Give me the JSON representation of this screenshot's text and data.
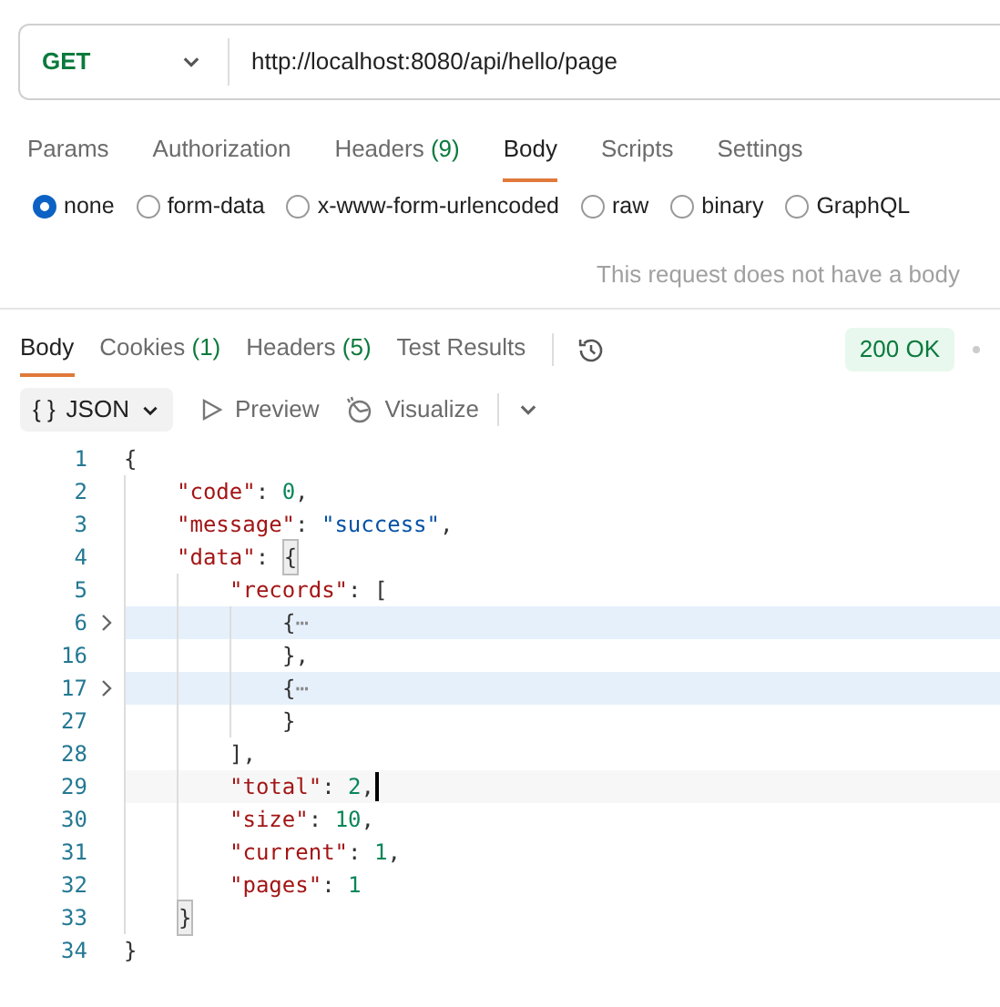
{
  "request": {
    "method": "GET",
    "url": "http://localhost:8080/api/hello/page"
  },
  "request_tabs": [
    {
      "label": "Params",
      "selected": false
    },
    {
      "label": "Authorization",
      "selected": false
    },
    {
      "label": "Headers",
      "count": "(9)",
      "selected": false
    },
    {
      "label": "Body",
      "selected": true
    },
    {
      "label": "Scripts",
      "selected": false
    },
    {
      "label": "Settings",
      "selected": false
    }
  ],
  "body_types": [
    {
      "label": "none",
      "selected": true
    },
    {
      "label": "form-data",
      "selected": false
    },
    {
      "label": "x-www-form-urlencoded",
      "selected": false
    },
    {
      "label": "raw",
      "selected": false
    },
    {
      "label": "binary",
      "selected": false
    },
    {
      "label": "GraphQL",
      "selected": false
    }
  ],
  "body_message": "This request does not have a body",
  "response_tabs": [
    {
      "label": "Body",
      "selected": true
    },
    {
      "label": "Cookies",
      "count": "(1)",
      "selected": false
    },
    {
      "label": "Headers",
      "count": "(5)",
      "selected": false
    },
    {
      "label": "Test Results",
      "selected": false
    }
  ],
  "status": "200 OK",
  "format": {
    "brace": "{ }",
    "label": "JSON"
  },
  "view_buttons": [
    {
      "label": "Preview",
      "kind": "preview"
    },
    {
      "label": "Visualize",
      "kind": "visualize"
    }
  ],
  "code_lines": [
    {
      "number": "1",
      "folded": false,
      "current": false,
      "tokens": [
        {
          "kind": "punct",
          "text": "{"
        }
      ]
    },
    {
      "number": "2",
      "folded": false,
      "current": false,
      "tokens": [
        {
          "kind": "key",
          "text": "    \"code\""
        },
        {
          "kind": "punct",
          "text": ": "
        },
        {
          "kind": "number",
          "text": "0"
        },
        {
          "kind": "punct",
          "text": ","
        }
      ]
    },
    {
      "number": "3",
      "folded": false,
      "current": false,
      "tokens": [
        {
          "kind": "key",
          "text": "    \"message\""
        },
        {
          "kind": "punct",
          "text": ": "
        },
        {
          "kind": "string",
          "text": "\"success\""
        },
        {
          "kind": "punct",
          "text": ","
        }
      ]
    },
    {
      "number": "4",
      "folded": false,
      "current": false,
      "tokens": [
        {
          "kind": "key",
          "text": "    \"data\""
        },
        {
          "kind": "punct",
          "text": ": "
        },
        {
          "kind": "match",
          "text": "{"
        }
      ]
    },
    {
      "number": "5",
      "folded": false,
      "current": false,
      "tokens": [
        {
          "kind": "key",
          "text": "        \"records\""
        },
        {
          "kind": "punct",
          "text": ": ["
        }
      ]
    },
    {
      "number": "6",
      "folded": true,
      "current": false,
      "tokens": [
        {
          "kind": "punct",
          "text": "            {"
        },
        {
          "kind": "fold",
          "text": "⋯"
        }
      ]
    },
    {
      "number": "16",
      "folded": false,
      "current": false,
      "tokens": [
        {
          "kind": "punct",
          "text": "            },"
        }
      ]
    },
    {
      "number": "17",
      "folded": true,
      "current": false,
      "tokens": [
        {
          "kind": "punct",
          "text": "            {"
        },
        {
          "kind": "fold",
          "text": "⋯"
        }
      ]
    },
    {
      "number": "27",
      "folded": false,
      "current": false,
      "tokens": [
        {
          "kind": "punct",
          "text": "            }"
        }
      ]
    },
    {
      "number": "28",
      "folded": false,
      "current": false,
      "tokens": [
        {
          "kind": "punct",
          "text": "        ],"
        }
      ]
    },
    {
      "number": "29",
      "folded": false,
      "current": true,
      "tokens": [
        {
          "kind": "key",
          "text": "        \"total\""
        },
        {
          "kind": "punct",
          "text": ": "
        },
        {
          "kind": "number",
          "text": "2"
        },
        {
          "kind": "punct",
          "text": ","
        }
      ]
    },
    {
      "number": "30",
      "folded": false,
      "current": false,
      "tokens": [
        {
          "kind": "key",
          "text": "        \"size\""
        },
        {
          "kind": "punct",
          "text": ": "
        },
        {
          "kind": "number",
          "text": "10"
        },
        {
          "kind": "punct",
          "text": ","
        }
      ]
    },
    {
      "number": "31",
      "folded": false,
      "current": false,
      "tokens": [
        {
          "kind": "key",
          "text": "        \"current\""
        },
        {
          "kind": "punct",
          "text": ": "
        },
        {
          "kind": "number",
          "text": "1"
        },
        {
          "kind": "punct",
          "text": ","
        }
      ]
    },
    {
      "number": "32",
      "folded": false,
      "current": false,
      "tokens": [
        {
          "kind": "key",
          "text": "        \"pages\""
        },
        {
          "kind": "punct",
          "text": ": "
        },
        {
          "kind": "number",
          "text": "1"
        }
      ]
    },
    {
      "number": "33",
      "folded": false,
      "current": false,
      "tokens": [
        {
          "kind": "match",
          "text": "    }"
        }
      ]
    },
    {
      "number": "34",
      "folded": false,
      "current": false,
      "tokens": [
        {
          "kind": "punct",
          "text": "}"
        }
      ]
    }
  ]
}
